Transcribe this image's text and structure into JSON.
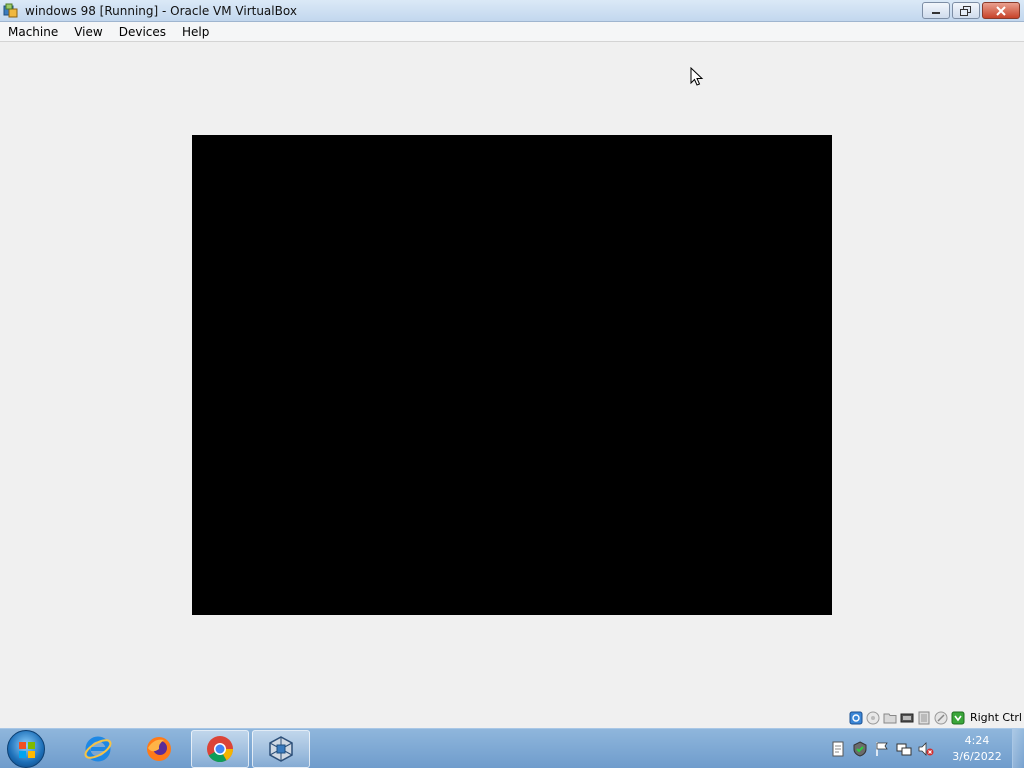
{
  "window": {
    "title": "windows 98 [Running] - Oracle VM VirtualBox",
    "icon": "virtualbox-icon"
  },
  "menubar": {
    "items": [
      "Machine",
      "View",
      "Devices",
      "Help"
    ]
  },
  "statusbar": {
    "icons": [
      "hard-disk-icon",
      "optical-drive-icon",
      "shared-folders-icon",
      "network-icon",
      "usb-icon",
      "display-icon",
      "mouse-integration-icon"
    ],
    "host_key": "Right Ctrl"
  },
  "taskbar": {
    "apps": [
      "internet-explorer-icon",
      "firefox-icon",
      "chrome-icon",
      "virtualbox-icon"
    ],
    "active_app": "chrome-icon",
    "tray_icons": [
      "notes-icon",
      "security-icon",
      "action-center-flag-icon",
      "network-tray-icon",
      "volume-muted-icon"
    ],
    "time": "4:24",
    "date": "3/6/2022"
  },
  "colors": {
    "vm_screen": "#000000",
    "background": "#f0f0f0",
    "taskbar": "#7ea8d4"
  }
}
